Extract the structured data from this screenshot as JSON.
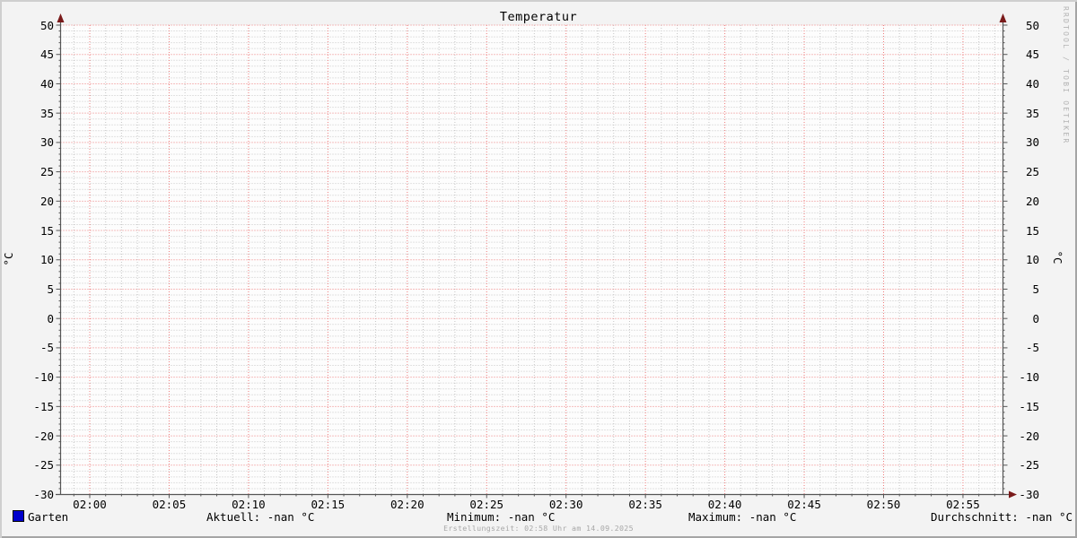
{
  "title": "Temperatur",
  "watermark": "RRDTOOL / TOBI OETIKER",
  "y_axis": {
    "left_label": "°C",
    "right_label": "°C"
  },
  "legend": {
    "series_label": "Garten",
    "series_color": "#0000cc"
  },
  "stats": {
    "aktuell": "Aktuell: -nan °C",
    "minimum": "Minimum: -nan °C",
    "maximum": "Maximum: -nan °C",
    "durchschnitt": "Durchschnitt: -nan °C"
  },
  "footer": {
    "creation_time": "Erstellungszeit: 02:58 Uhr am 14.09.2025"
  },
  "colors": {
    "background": "#f3f3f3",
    "canvas": "#fdfdfd",
    "major_grid": "#ee7d7d",
    "minor_grid": "#c6c6c6",
    "axis": "#565656",
    "arrow": "#7a1a1a",
    "series": "#0000cc",
    "watermark_text": "#b3b3b3",
    "footer_text": "#a8a8a8",
    "bevel_light": "#cfcfcf",
    "bevel_dark": "#a5a5a5"
  },
  "chart_data": {
    "type": "line",
    "title": "Temperatur",
    "xlabel": "",
    "ylabel": "°C",
    "x_ticks": [
      "02:00",
      "02:05",
      "02:10",
      "02:15",
      "02:20",
      "02:25",
      "02:30",
      "02:35",
      "02:40",
      "02:45",
      "02:50",
      "02:55"
    ],
    "y_ticks": [
      50,
      45,
      40,
      35,
      30,
      25,
      20,
      15,
      10,
      5,
      0,
      -5,
      -10,
      -15,
      -20,
      -25,
      -30
    ],
    "ylim": [
      -30,
      50
    ],
    "y_major_step": 5,
    "y_minor_step": 1,
    "x_major_step_minutes": 5,
    "x_minor_step_minutes": 1,
    "grid": true,
    "legend_position": "bottom-left",
    "series": [
      {
        "name": "Garten",
        "color": "#0000cc",
        "values": []
      }
    ],
    "series_stats": {
      "aktuell": "-nan °C",
      "minimum": "-nan °C",
      "maximum": "-nan °C",
      "durchschnitt": "-nan °C"
    }
  }
}
